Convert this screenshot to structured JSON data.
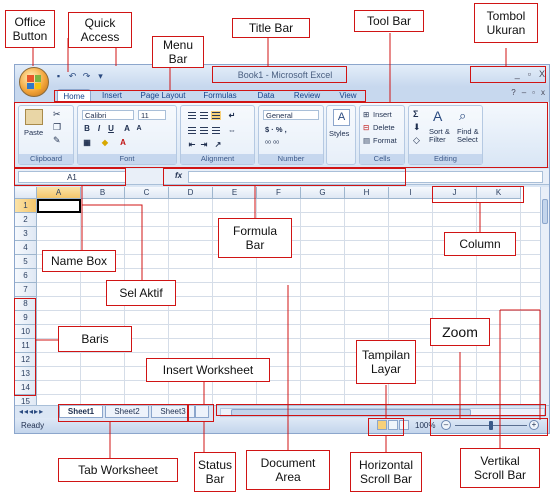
{
  "window": {
    "title": "Book1 - Microsoft Excel",
    "controls": [
      "_",
      "▫",
      "X"
    ]
  },
  "ribbon": {
    "tabs": [
      "Home",
      "Insert",
      "Page Layout",
      "Formulas",
      "Data",
      "Review",
      "View"
    ],
    "active_tab": "Home",
    "clipboard": {
      "paste": "Paste",
      "label": "Clipboard"
    },
    "font": {
      "name": "Calibri",
      "size": "11",
      "label": "Font"
    },
    "alignment": {
      "label": "Alignment"
    },
    "number": {
      "format": "General",
      "symbols": "$ · % ,",
      "label": "Number"
    },
    "styles": {
      "button": "Styles"
    },
    "cells": {
      "insert": "Insert",
      "delete": "Delete",
      "format": "Format",
      "label": "Cells"
    },
    "editing": {
      "sort": "Sort & Filter",
      "find": "Find & Select",
      "label": "Editing"
    }
  },
  "formula_bar": {
    "name_box": "A1",
    "fx": "fx"
  },
  "grid": {
    "columns": [
      "A",
      "B",
      "C",
      "D",
      "E",
      "F",
      "G",
      "H",
      "I",
      "J",
      "K"
    ],
    "rows": [
      "1",
      "2",
      "3",
      "4",
      "5",
      "6",
      "7",
      "8",
      "9",
      "10",
      "11",
      "12",
      "13",
      "14",
      "15"
    ]
  },
  "sheets": [
    "Sheet1",
    "Sheet2",
    "Sheet3"
  ],
  "status": {
    "text": "Ready",
    "zoom": "100%",
    "zoom_fraction": 0.5
  },
  "annotations": {
    "office_button": [
      "Office",
      "Button"
    ],
    "quick_access": [
      "Quick",
      "Access"
    ],
    "menu_bar": [
      "Menu",
      "Bar"
    ],
    "title_bar": "Title Bar",
    "tool_bar": "Tool Bar",
    "tombol_ukuran": [
      "Tombol",
      "Ukuran"
    ],
    "formula_bar": [
      "Formula",
      "Bar"
    ],
    "column": "Column",
    "name_box": "Name Box",
    "sel_aktif": "Sel Aktif",
    "baris": "Baris",
    "zoom": "Zoom",
    "tampilan_layar": [
      "Tampilan",
      "Layar"
    ],
    "insert_worksheet": "Insert Worksheet",
    "tab_worksheet": "Tab Worksheet",
    "status_bar": [
      "Status",
      "Bar"
    ],
    "document_area": [
      "Document",
      "Area"
    ],
    "horizontal_scroll": [
      "Horizontal",
      "Scroll Bar"
    ],
    "vertikal_scroll": [
      "Vertikal",
      "Scroll Bar"
    ]
  }
}
